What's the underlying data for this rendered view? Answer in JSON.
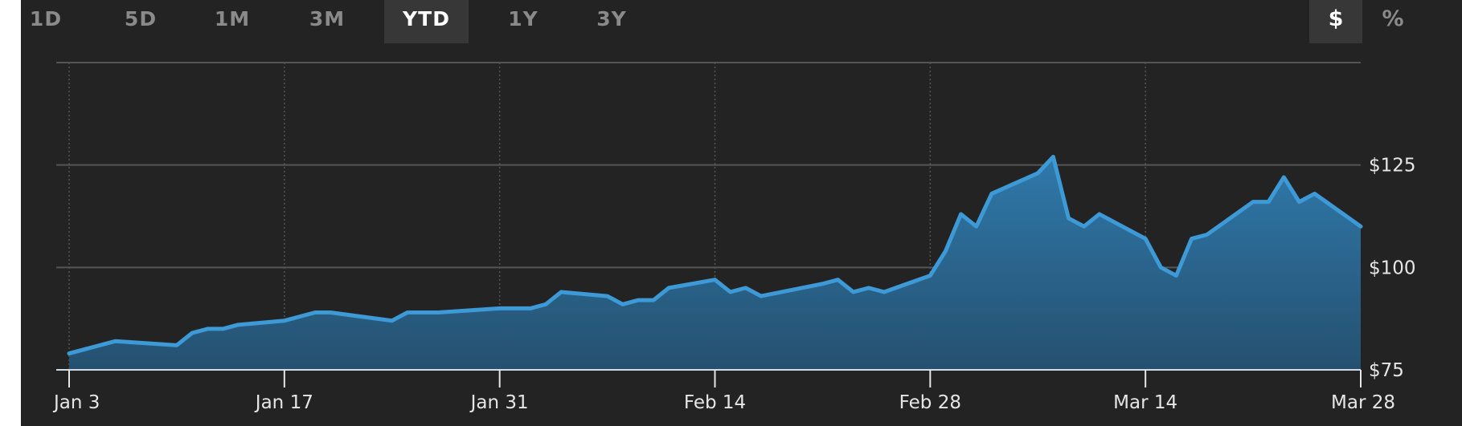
{
  "range_tabs": [
    {
      "label": "1D",
      "active": false
    },
    {
      "label": "5D",
      "active": false
    },
    {
      "label": "1M",
      "active": false
    },
    {
      "label": "3M",
      "active": false
    },
    {
      "label": "YTD",
      "active": true
    },
    {
      "label": "1Y",
      "active": false
    },
    {
      "label": "3Y",
      "active": false
    }
  ],
  "unit_tabs": [
    {
      "label": "$",
      "active": true
    },
    {
      "label": "%",
      "active": false
    }
  ],
  "colors": {
    "background": "#232323",
    "line": "#3d9ad6",
    "fill_top": "#2f79ab",
    "fill_bottom": "#25506f",
    "grid": "#555555"
  },
  "chart_data": {
    "type": "area",
    "xlabel": "",
    "ylabel": "",
    "x_tick_labels": [
      "Jan 3",
      "Jan 17",
      "Jan 31",
      "Feb 14",
      "Feb 28",
      "Mar 14",
      "Mar 28"
    ],
    "y_tick_labels": [
      "$75",
      "$100",
      "$125"
    ],
    "y_ticks": [
      75,
      100,
      125
    ],
    "ylim": [
      75,
      150
    ],
    "xlim": [
      0,
      84
    ],
    "grid": true,
    "x_note": "x values are trading-day offsets measured in calendar days from Jan 3",
    "x": [
      0,
      1,
      2,
      3,
      7,
      8,
      9,
      10,
      11,
      14,
      15,
      16,
      17,
      21,
      22,
      23,
      24,
      28,
      29,
      30,
      31,
      32,
      35,
      36,
      37,
      38,
      39,
      42,
      43,
      44,
      45,
      49,
      50,
      51,
      52,
      53,
      56,
      57,
      58,
      59,
      60,
      63,
      64,
      65,
      66,
      67,
      70,
      71,
      72,
      73,
      74,
      77,
      78,
      79,
      80,
      81,
      84
    ],
    "values": [
      79,
      80,
      81,
      82,
      81,
      84,
      85,
      85,
      86,
      87,
      88,
      89,
      89,
      87,
      89,
      89,
      89,
      90,
      90,
      90,
      91,
      94,
      93,
      91,
      92,
      92,
      95,
      97,
      94,
      95,
      93,
      96,
      97,
      94,
      95,
      94,
      98,
      104,
      113,
      110,
      118,
      123,
      127,
      112,
      110,
      113,
      107,
      100,
      98,
      107,
      108,
      116,
      116,
      122,
      116,
      118,
      110
    ]
  }
}
